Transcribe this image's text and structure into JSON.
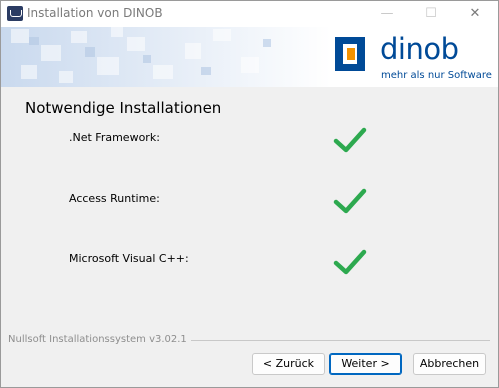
{
  "window": {
    "title": "Installation von DINOB",
    "minimize_glyph": "—",
    "maximize_glyph": "☐",
    "close_glyph": "✕"
  },
  "banner": {
    "logo_word": "dinob",
    "logo_tagline": "mehr als nur Software",
    "brand_blue": "#004a97",
    "brand_orange": "#f39200"
  },
  "page": {
    "title": "Notwendige Installationen",
    "items": [
      {
        "label": ".Net Framework:",
        "status": "installed",
        "icon": "checkmark-icon"
      },
      {
        "label": "Access Runtime:",
        "status": "installed",
        "icon": "checkmark-icon"
      },
      {
        "label": "Microsoft Visual C++:",
        "status": "installed",
        "icon": "checkmark-icon"
      }
    ],
    "check_color": "#2da94f"
  },
  "footer": {
    "branding": "Nullsoft Installationssystem v3.02.1",
    "back_label": "< Zurück",
    "next_label": "Weiter >",
    "cancel_label": "Abbrechen"
  }
}
